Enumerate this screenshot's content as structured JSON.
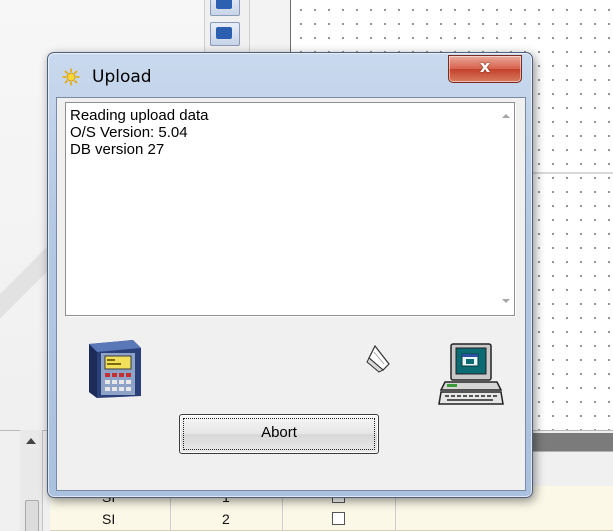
{
  "dialog": {
    "title": "Upload",
    "close_label": "x",
    "log_lines": [
      "Reading upload data",
      "O/S Version: 5.04",
      "DB version 27"
    ],
    "abort_label": "Abort"
  },
  "background_table": {
    "rows": [
      {
        "name": "SI",
        "value": "1"
      },
      {
        "name": "SI",
        "value": "2"
      }
    ]
  },
  "icons": {
    "title": "upload-sun-icon",
    "source_device": "plc-controller-icon",
    "transfer": "paper-flying-icon",
    "target": "computer-icon"
  },
  "colors": {
    "close_button": "#c4412c",
    "frame": "#b3c8e3",
    "client": "#f0f0f0"
  }
}
